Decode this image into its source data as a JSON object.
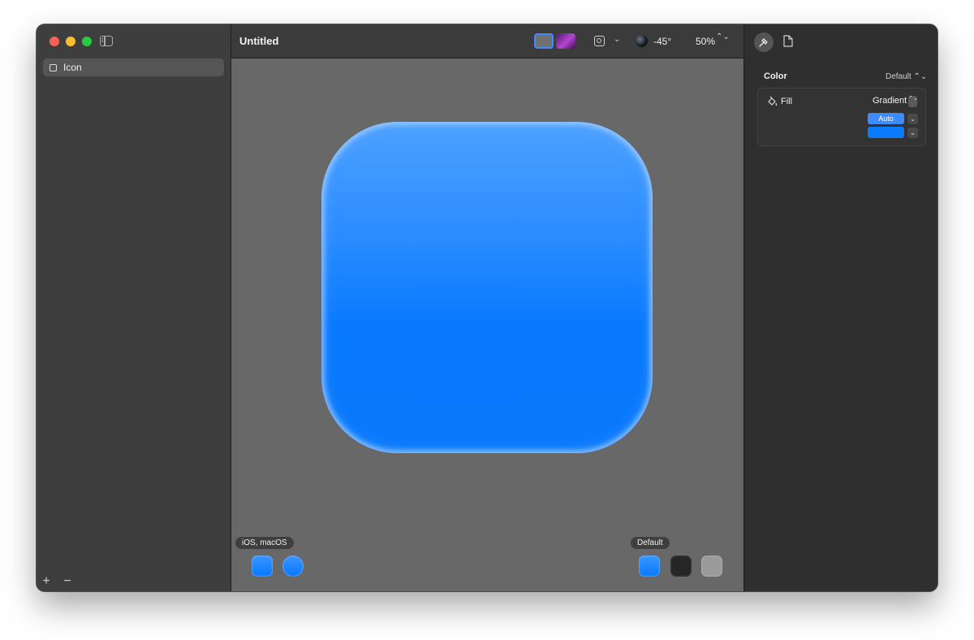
{
  "sidebar": {
    "layers": [
      {
        "label": "Icon"
      }
    ],
    "add_label": "+",
    "remove_label": "−"
  },
  "toolbar": {
    "title": "Untitled",
    "light_angle": "-45°",
    "zoom": "50%",
    "zoom_stepper": "⌃⌄",
    "dropdown_chevron": "⌄"
  },
  "canvas": {
    "platform_tag": "iOS, macOS",
    "appearance_tag": "Default",
    "icon_gradient": [
      "#4da1ff",
      "#0779ff"
    ]
  },
  "inspector": {
    "section_title": "Color",
    "section_value": "Default ⌃⌄",
    "fill_label": "Fill",
    "fill_mode": "Gradient",
    "fill_mode_stepper": "⌃⌄",
    "stops": [
      {
        "label": "Auto",
        "color": "#3d8bff"
      },
      {
        "label": "",
        "color": "#0a7aff"
      }
    ],
    "stop_chevron": "⌄"
  },
  "colors": {
    "accent": "#3d8bff",
    "close": "#ff5f57",
    "minimize": "#febc2e",
    "zoom": "#28c840"
  }
}
